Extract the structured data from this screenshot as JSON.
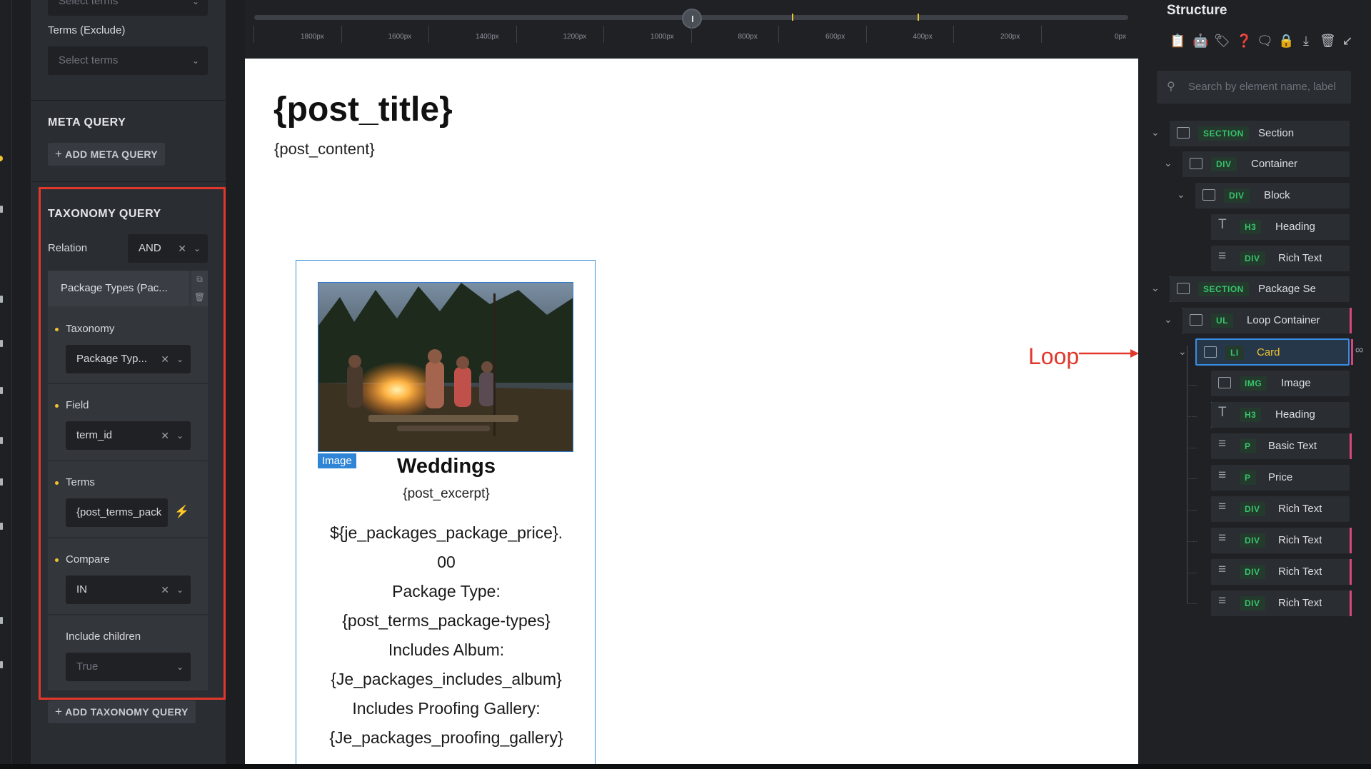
{
  "left_panel": {
    "select_terms_top_placeholder": "Select terms",
    "terms_exclude_label": "Terms (Exclude)",
    "terms_exclude_placeholder": "Select terms",
    "meta_query_title": "META QUERY",
    "add_meta_query_label": "ADD META QUERY",
    "taxonomy_query_title": "TAXONOMY QUERY",
    "relation_label": "Relation",
    "relation_value": "AND",
    "group_title": "Package Types (Pac...",
    "taxonomy_label": "Taxonomy",
    "taxonomy_value": "Package Typ...",
    "field_label": "Field",
    "field_value": "term_id",
    "terms_label": "Terms",
    "terms_value": "{post_terms_pack",
    "compare_label": "Compare",
    "compare_value": "IN",
    "include_children_label": "Include children",
    "include_children_value": "True",
    "add_taxonomy_query_label": "ADD TAXONOMY QUERY",
    "highlight_color": "#e2372b"
  },
  "ruler": {
    "labels": [
      "1800px",
      "1600px",
      "1400px",
      "1200px",
      "1000px",
      "800px",
      "600px",
      "400px",
      "200px",
      "0px"
    ]
  },
  "canvas": {
    "post_title": "{post_title}",
    "post_content": "{post_content}",
    "card": {
      "image_badge": "Image",
      "heading": "Weddings",
      "excerpt": "{post_excerpt}",
      "lines": [
        "${je_packages_package_price}.",
        "00",
        "Package Type:",
        "{post_terms_package-types}",
        "Includes Album:",
        "{Je_packages_includes_album}",
        "Includes Proofing Gallery:",
        "{Je_packages_proofing_gallery}"
      ]
    },
    "annotation_label": "Loop"
  },
  "structure": {
    "title": "Structure",
    "toolbar_icons": [
      "clipboard-icon",
      "robot-icon",
      "tag-icon",
      "help-icon",
      "comment-icon",
      "lock-icon",
      "download-icon",
      "trash-icon",
      "collapse-icon"
    ],
    "search_placeholder": "Search by element name, label",
    "nodes": [
      {
        "tag": "SECTION",
        "label": "Section"
      },
      {
        "tag": "DIV",
        "label": "Container"
      },
      {
        "tag": "DIV",
        "label": "Block"
      },
      {
        "tag": "H3",
        "label": "Heading"
      },
      {
        "tag": "DIV",
        "label": "Rich Text"
      },
      {
        "tag": "SECTION",
        "label": "Package Se"
      },
      {
        "tag": "UL",
        "label": "Loop Container"
      },
      {
        "tag": "LI",
        "label": "Card"
      },
      {
        "tag": "IMG",
        "label": "Image"
      },
      {
        "tag": "H3",
        "label": "Heading"
      },
      {
        "tag": "P",
        "label": "Basic Text"
      },
      {
        "tag": "P",
        "label": "Price"
      },
      {
        "tag": "DIV",
        "label": "Rich Text"
      },
      {
        "tag": "DIV",
        "label": "Rich Text"
      },
      {
        "tag": "DIV",
        "label": "Rich Text"
      },
      {
        "tag": "DIV",
        "label": "Rich Text"
      }
    ]
  }
}
